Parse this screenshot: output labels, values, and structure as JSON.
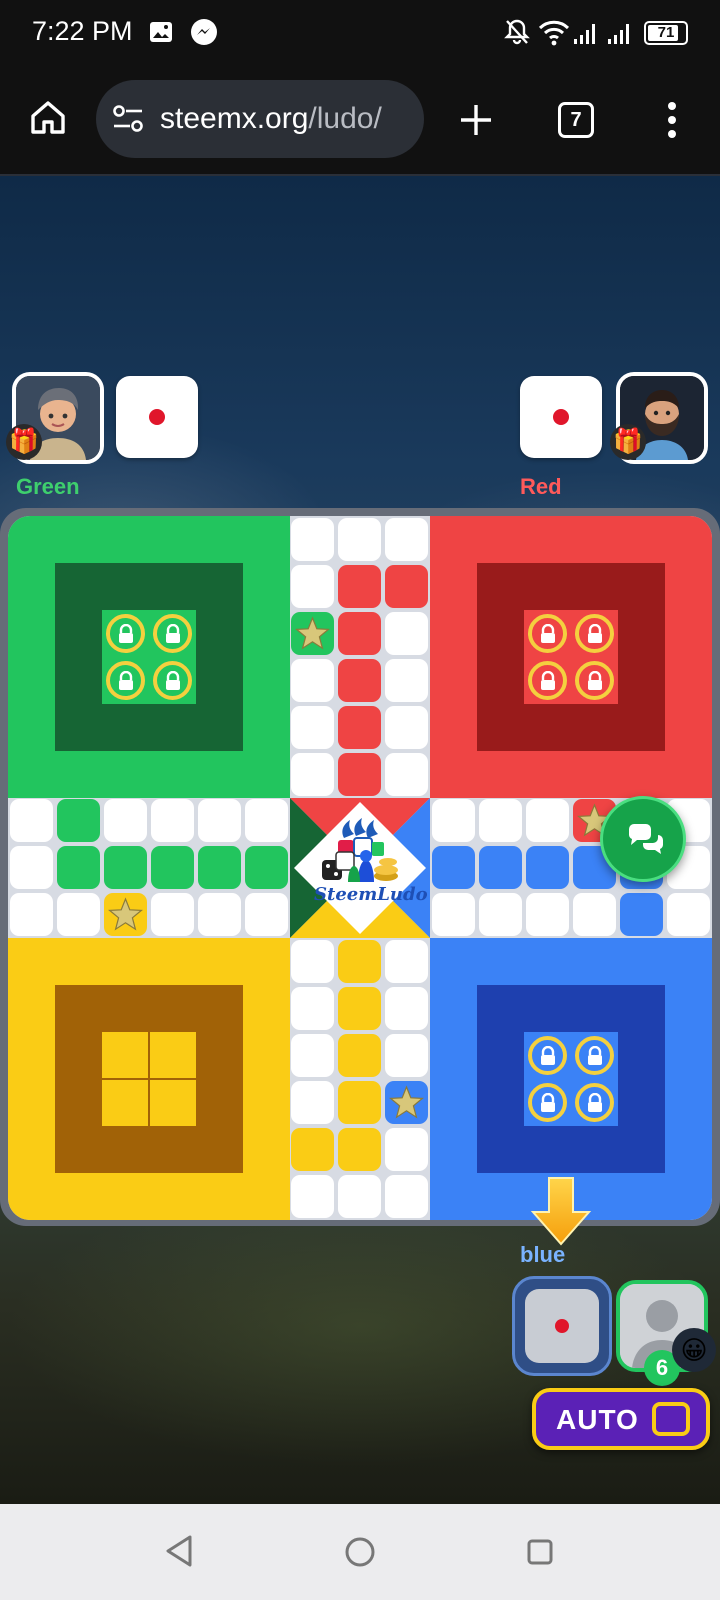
{
  "status_bar": {
    "time": "7:22 PM",
    "battery": "71",
    "icons": [
      "gallery-icon",
      "messenger-icon",
      "bell-off-icon",
      "wifi-icon",
      "signal-icon",
      "signal-icon",
      "battery-icon"
    ]
  },
  "browser": {
    "url_domain": "steemx.org",
    "url_path": "/ludo/",
    "tab_count": "7"
  },
  "players": {
    "green": {
      "name": "Green",
      "color": "#3ecf6d"
    },
    "red": {
      "name": "Red",
      "color": "#ff5a5a"
    },
    "blue": {
      "name": "blue",
      "color": "#7ab3ff",
      "score": "6"
    }
  },
  "board": {
    "colors": {
      "green": "#22c55e",
      "green_dark": "#166534",
      "red": "#ef4444",
      "red_dark": "#991b1b",
      "yellow": "#facc15",
      "yellow_dark": "#a16207",
      "blue": "#3b82f6",
      "blue_dark": "#1e40af",
      "cell": "#ffffff"
    },
    "logo_text": "SteemLudo"
  },
  "controls": {
    "auto_label": "AUTO"
  }
}
